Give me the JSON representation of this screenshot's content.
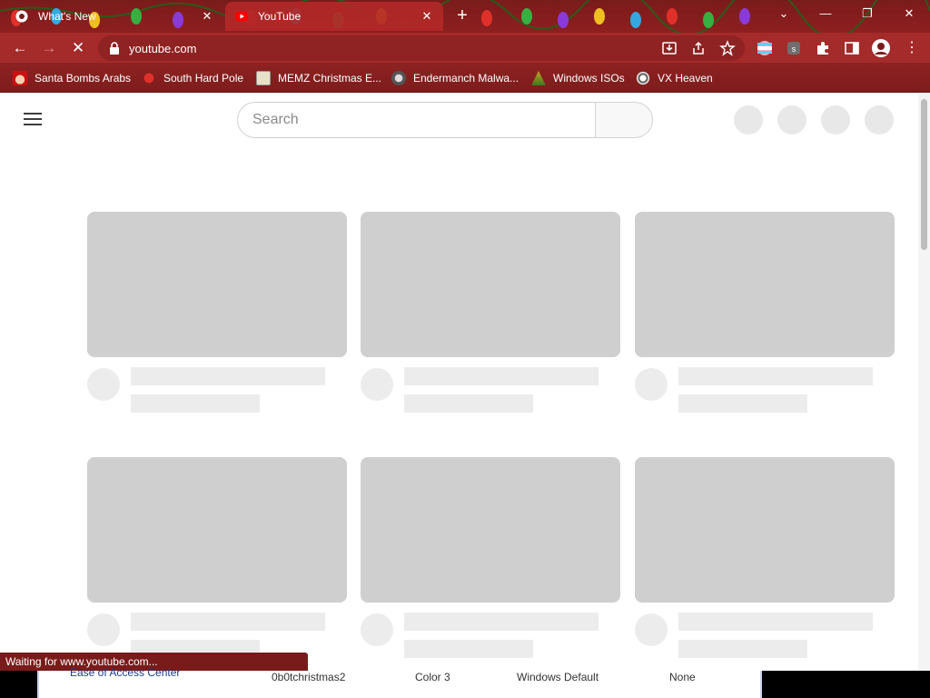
{
  "browser": {
    "tabs": [
      {
        "title": "What's New",
        "active": false,
        "favicon": "chrome-icon"
      },
      {
        "title": "YouTube",
        "active": true,
        "favicon": "youtube-icon"
      }
    ],
    "url": "youtube.com",
    "bookmarks": [
      {
        "label": "Santa Bombs Arabs",
        "icon": "santa-icon"
      },
      {
        "label": "South Hard Pole",
        "icon": "virus-icon"
      },
      {
        "label": "MEMZ Christmas E...",
        "icon": "memz-icon"
      },
      {
        "label": "Endermanch Malwa...",
        "icon": "raccoon-icon"
      },
      {
        "label": "Windows ISOs",
        "icon": "tree-icon"
      },
      {
        "label": "VX Heaven",
        "icon": "biohazard-icon"
      }
    ],
    "status_text": "Waiting for www.youtube.com...",
    "colors": {
      "theme": "#a52a2a",
      "dark": "#7a1b1b"
    }
  },
  "youtube": {
    "search_placeholder": "Search",
    "skeleton_color": "#cfcfcf"
  },
  "underlying_window": {
    "link": "Ease of Access Center",
    "columns": [
      "0b0tchristmas2",
      "Color 3",
      "Windows Default",
      "None"
    ]
  }
}
